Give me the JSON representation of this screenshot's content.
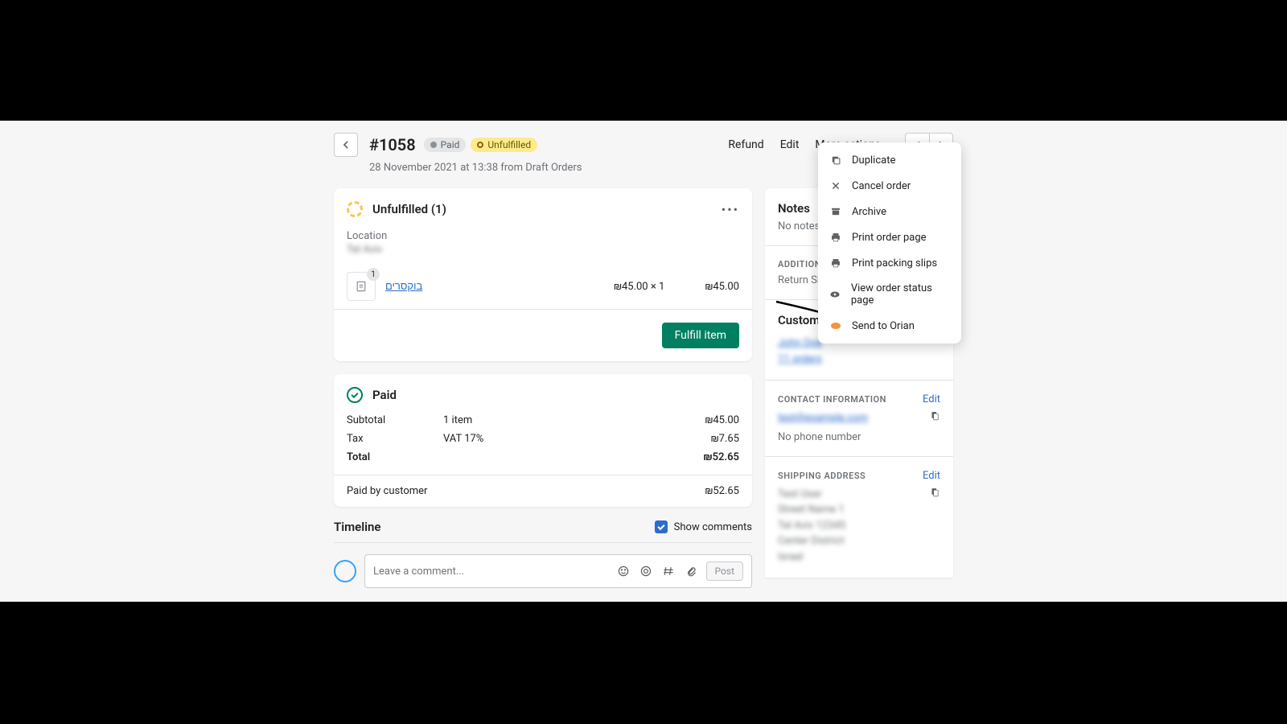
{
  "header": {
    "order_number": "#1058",
    "paid_badge": "Paid",
    "unfulfilled_badge": "Unfulfilled",
    "datetime": "28 November 2021 at 13:38 from Draft Orders",
    "refund": "Refund",
    "edit": "Edit",
    "more_actions": "More actions"
  },
  "dropdown": {
    "duplicate": "Duplicate",
    "cancel": "Cancel order",
    "archive": "Archive",
    "print_order": "Print order page",
    "print_packing": "Print packing slips",
    "view_status": "View order status page",
    "send_orian": "Send to Orian"
  },
  "fulfill": {
    "title": "Unfulfilled (1)",
    "location_label": "Location",
    "location_value": "Tel Aviv",
    "product_name": "בוקסרים",
    "qty_badge": "1",
    "unit_price": "₪45.00 × 1",
    "line_total": "₪45.00",
    "button": "Fulfill item"
  },
  "paid": {
    "title": "Paid",
    "subtotal_label": "Subtotal",
    "subtotal_detail": "1 item",
    "subtotal_value": "₪45.00",
    "tax_label": "Tax",
    "tax_detail": "VAT 17%",
    "tax_value": "₪7.65",
    "total_label": "Total",
    "total_value": "₪52.65",
    "paid_by_label": "Paid by customer",
    "paid_by_value": "₪52.65"
  },
  "timeline": {
    "title": "Timeline",
    "show_comments": "Show comments",
    "placeholder": "Leave a comment...",
    "post": "Post"
  },
  "sidebar": {
    "notes_title": "Notes",
    "no_notes": "No notes",
    "additional_title": "ADDITIONAL",
    "return_sh": "Return Sh",
    "customer_title": "Customer",
    "customer_name": "John Doe",
    "customer_orders": "11 orders",
    "contact_title": "CONTACT INFORMATION",
    "contact_email": "test@example.com",
    "no_phone": "No phone number",
    "shipping_title": "SHIPPING ADDRESS",
    "ship1": "Test User",
    "ship2": "Street Name 1",
    "ship3": "Tel Aviv 12345",
    "ship4": "Center District",
    "ship5": "Israel",
    "edit": "Edit"
  }
}
